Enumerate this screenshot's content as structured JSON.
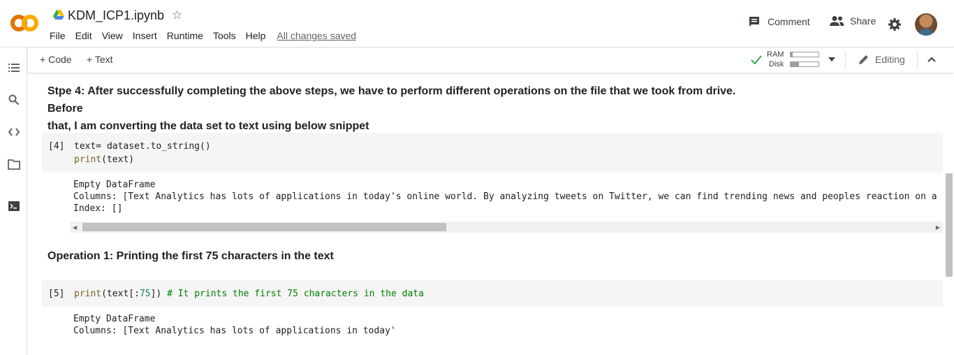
{
  "header": {
    "file_name": "KDM_ICP1.ipynb",
    "menu": [
      "File",
      "Edit",
      "View",
      "Insert",
      "Runtime",
      "Tools",
      "Help"
    ],
    "save_status": "All changes saved",
    "comment_label": "Comment",
    "share_label": "Share"
  },
  "toolbar": {
    "add_code_label": "Code",
    "add_text_label": "Text",
    "ram_label": "RAM",
    "disk_label": "Disk",
    "ram_usage": 0.08,
    "disk_usage": 0.3,
    "editing_label": "Editing"
  },
  "cells": {
    "text1_line1": "Stpe 4: After successfully completing the above steps, we have to perform different operations on the file that we took from drive. Before",
    "text1_line2": "that, I am converting the data set to text using below snippet",
    "code1_prompt": "[4]",
    "code1_line1": "text= dataset.to_string()",
    "code1_line2_fn": "print",
    "code1_line2_rest": "(text)",
    "out1_line1": "Empty DataFrame",
    "out1_line2": "Columns: [Text Analytics has lots of applications in today's online world. By analyzing tweets on Twitter, we can find trending news and peoples reaction on a par",
    "out1_line3": "Index: []",
    "text2": "Operation 1: Printing the first 75 characters in the text",
    "code2_prompt": "[5]",
    "code2_fn": "print",
    "code2_open": "(text[:",
    "code2_num": "75",
    "code2_close": "]) ",
    "code2_comment": "# It prints the first 75 characters in the data",
    "out2_line1": "Empty DataFrame",
    "out2_line2": "Columns: [Text Analytics has lots of applications in today'"
  },
  "colors": {
    "logo_orange": "#f9ab00",
    "logo_dark": "#e37400",
    "check_green": "#34a853"
  }
}
